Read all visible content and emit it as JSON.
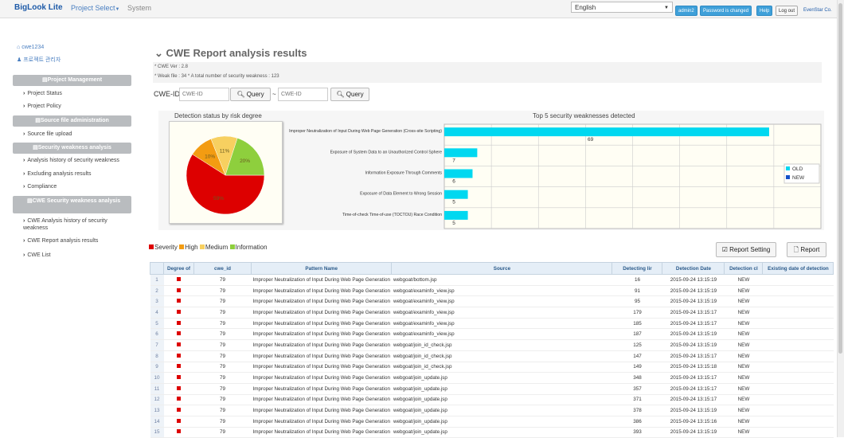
{
  "topbar": {
    "brand": "BigLook Lite",
    "nav": [
      "Project Select",
      "System"
    ],
    "language": "English",
    "buttons": [
      "admin2",
      "Password is changed",
      "Help",
      "Log out"
    ],
    "user_company": "EvenStar Co."
  },
  "sidebar": {
    "user": "cwe1234",
    "role": "프로젝트 관리자",
    "sections": [
      {
        "header": "Project Management",
        "items": [
          "Project Status",
          "Project Policy"
        ]
      },
      {
        "header": "Source file administration",
        "items": [
          "Source file upload"
        ]
      },
      {
        "header": "Security weakness analysis",
        "items": [
          "Analysis history of security weakness",
          "Excluding analysis results",
          "Compliance"
        ]
      },
      {
        "header": "CWE Security weakness analysis",
        "items": [
          "CWE Analysis history of security weakness",
          "CWE Report analysis results",
          "CWE List"
        ]
      }
    ]
  },
  "main": {
    "title": "CWE Report analysis results",
    "info_line1": "* CWE Ver : 2.8",
    "info_line2": "* Weak file : 34    * A total number of security weakness : 123",
    "search": {
      "label": "CWE-ID",
      "from_placeholder": "CWE-ID",
      "to_placeholder": "CWE-ID",
      "separator": "~",
      "query_label": "Query"
    },
    "legend": [
      "Severity",
      "High",
      "Medium",
      "Information"
    ],
    "buttons": {
      "report_setting": "Report Setting",
      "report": "Report"
    }
  },
  "colors": {
    "severity": "#dd0000",
    "high": "#f39c12",
    "medium": "#f7d060",
    "information": "#8ecf3d",
    "old": "#00d8f0",
    "new": "#1450c8"
  },
  "chart_data": [
    {
      "type": "pie",
      "title": "Detection status by risk degree",
      "labels": [
        "Severity",
        "High",
        "Medium",
        "Information"
      ],
      "values": [
        59,
        10,
        11,
        20
      ],
      "slice_labels": [
        "59%",
        "10%",
        "11%",
        "20%"
      ]
    },
    {
      "type": "bar",
      "orientation": "horizontal",
      "title": "Top 5 security weaknesses detected",
      "categories": [
        "Improper Neutralization of Input During Web Page Generation (Cross-site Scripting)",
        "Exposure of System Data to an Unauthorized Control Sphere",
        "Information Exposure Through Comments",
        "Exposure of Data Element to Wrong Session",
        "Time-of-check Time-of-use (TOCTOU) Race Condition"
      ],
      "series": [
        {
          "name": "OLD",
          "values": [
            69,
            7,
            6,
            5,
            5
          ]
        },
        {
          "name": "NEW",
          "values": [
            0,
            0,
            0,
            0,
            0
          ]
        }
      ],
      "data_labels": [
        "69",
        "7",
        "6",
        "5",
        "5"
      ],
      "xlim": [
        0,
        80
      ],
      "grid": true,
      "legend": "right"
    }
  ],
  "table": {
    "columns": [
      "Degree of",
      "cwe_id",
      "Pattern Name",
      "Source",
      "Detecting lir",
      "Detection Date",
      "Detection cl",
      "Existing date of detection"
    ],
    "rows": [
      [
        "1",
        "79",
        "Improper Neutralization of Input During Web Page Generation",
        "webgoat/bottom.jsp",
        "16",
        "2015-09-24 13:15:19",
        "NEW",
        ""
      ],
      [
        "2",
        "79",
        "Improper Neutralization of Input During Web Page Generation",
        "webgoat/examinfo_view.jsp",
        "91",
        "2015-09-24 13:15:19",
        "NEW",
        ""
      ],
      [
        "3",
        "79",
        "Improper Neutralization of Input During Web Page Generation",
        "webgoat/examinfo_view.jsp",
        "95",
        "2015-09-24 13:15:19",
        "NEW",
        ""
      ],
      [
        "4",
        "79",
        "Improper Neutralization of Input During Web Page Generation",
        "webgoat/examinfo_view.jsp",
        "179",
        "2015-09-24 13:15:17",
        "NEW",
        ""
      ],
      [
        "5",
        "79",
        "Improper Neutralization of Input During Web Page Generation",
        "webgoat/examinfo_view.jsp",
        "185",
        "2015-09-24 13:15:17",
        "NEW",
        ""
      ],
      [
        "6",
        "79",
        "Improper Neutralization of Input During Web Page Generation",
        "webgoat/examinfo_view.jsp",
        "187",
        "2015-09-24 13:15:19",
        "NEW",
        ""
      ],
      [
        "7",
        "79",
        "Improper Neutralization of Input During Web Page Generation",
        "webgoat/join_id_check.jsp",
        "125",
        "2015-09-24 13:15:19",
        "NEW",
        ""
      ],
      [
        "8",
        "79",
        "Improper Neutralization of Input During Web Page Generation",
        "webgoat/join_id_check.jsp",
        "147",
        "2015-09-24 13:15:17",
        "NEW",
        ""
      ],
      [
        "9",
        "79",
        "Improper Neutralization of Input During Web Page Generation",
        "webgoat/join_id_check.jsp",
        "149",
        "2015-09-24 13:15:18",
        "NEW",
        ""
      ],
      [
        "10",
        "79",
        "Improper Neutralization of Input During Web Page Generation",
        "webgoat/join_update.jsp",
        "348",
        "2015-09-24 13:15:17",
        "NEW",
        ""
      ],
      [
        "11",
        "79",
        "Improper Neutralization of Input During Web Page Generation",
        "webgoat/join_update.jsp",
        "357",
        "2015-09-24 13:15:17",
        "NEW",
        ""
      ],
      [
        "12",
        "79",
        "Improper Neutralization of Input During Web Page Generation",
        "webgoat/join_update.jsp",
        "371",
        "2015-09-24 13:15:17",
        "NEW",
        ""
      ],
      [
        "13",
        "79",
        "Improper Neutralization of Input During Web Page Generation",
        "webgoat/join_update.jsp",
        "378",
        "2015-09-24 13:15:19",
        "NEW",
        ""
      ],
      [
        "14",
        "79",
        "Improper Neutralization of Input During Web Page Generation",
        "webgoat/join_update.jsp",
        "386",
        "2015-09-24 13:15:16",
        "NEW",
        ""
      ],
      [
        "15",
        "79",
        "Improper Neutralization of Input During Web Page Generation",
        "webgoat/join_update.jsp",
        "393",
        "2015-09-24 13:15:19",
        "NEW",
        ""
      ]
    ]
  }
}
